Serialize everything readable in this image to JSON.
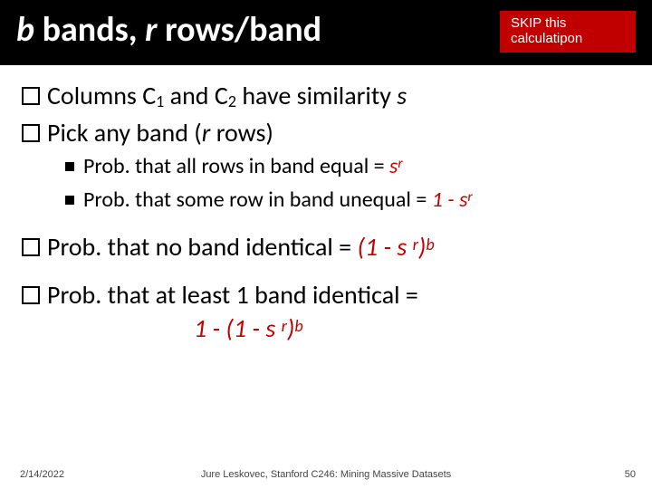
{
  "header": {
    "title_b": "b",
    "title_bands": " bands, ",
    "title_r": "r",
    "title_rows": " rows/band",
    "skip_l1": "SKIP this",
    "skip_l2": "calculatipon"
  },
  "body": {
    "l1_a": "Columns C",
    "l1_sub1": "1",
    "l1_b": " and C",
    "l1_sub2": "2",
    "l1_c": " have similarity ",
    "l1_s": "s",
    "l2_a": "Pick any band (",
    "l2_r": "r",
    "l2_b": " rows)",
    "s1_a": "Prob. that all rows in band equal = ",
    "s1_eq_base": "s",
    "s1_eq_sup": "r",
    "s2_a": "Prob. that some row in band unequal = ",
    "s2_eq_a": "1 - s",
    "s2_eq_sup": "r",
    "l3_a": "Prob. that no band identical  = ",
    "l3_eq_a": "(1 - s ",
    "l3_eq_sup1": "r",
    "l3_eq_b": ")",
    "l3_eq_sup2": "b",
    "l4_a": "Prob. that at least 1 band identical =",
    "l4_eq_a": "1 - (1 - s ",
    "l4_eq_sup1": "r",
    "l4_eq_b": ")",
    "l4_eq_sup2": "b"
  },
  "footer": {
    "date": "2/14/2022",
    "credit": "Jure Leskovec, Stanford C246: Mining Massive Datasets",
    "page": "50"
  }
}
